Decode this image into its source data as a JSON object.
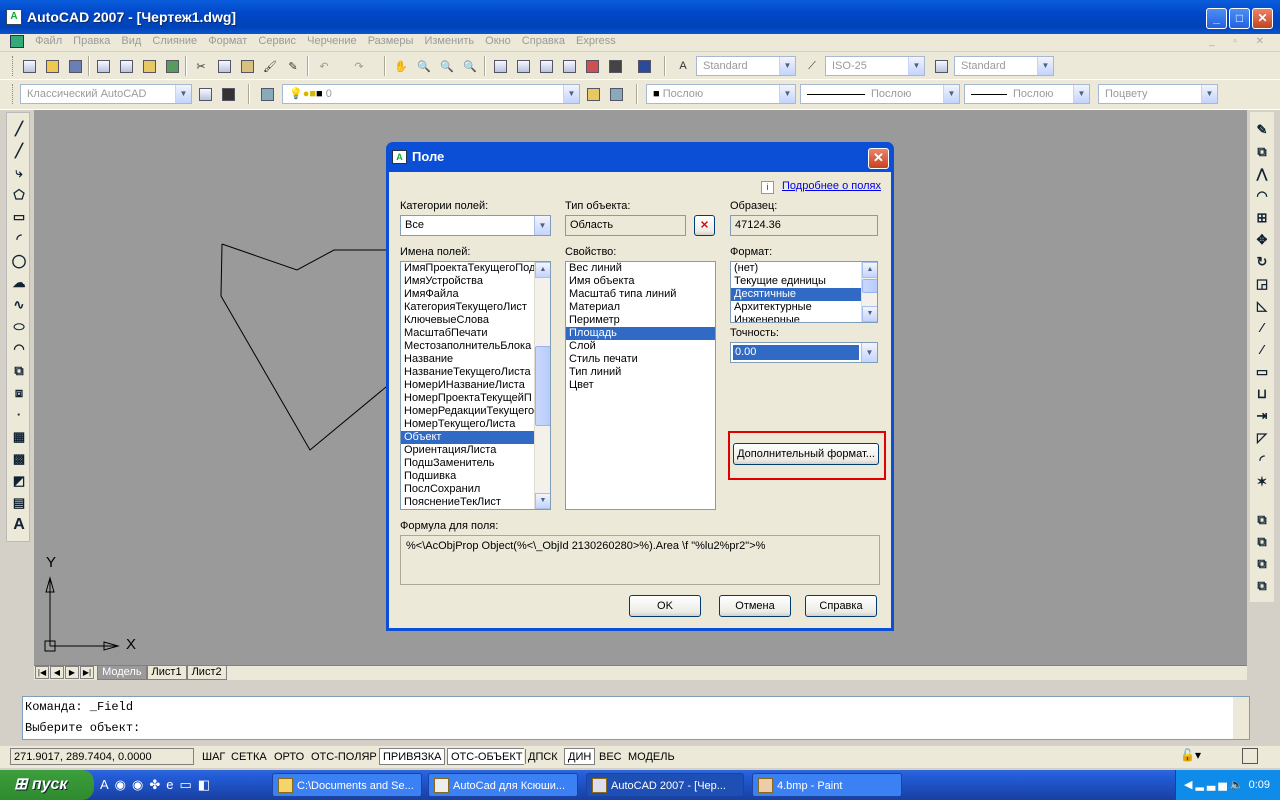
{
  "window": {
    "title": "AutoCAD 2007 - [Чертеж1.dwg]",
    "min": "_",
    "max": "□",
    "close": "✕"
  },
  "menu": [
    "Файл",
    "Правка",
    "Вид",
    "Слияние",
    "Формат",
    "Сервис",
    "Черчение",
    "Размеры",
    "Изменить",
    "Окно",
    "Справка",
    "Express"
  ],
  "toolbar": {
    "textstyle": "Standard",
    "dimstyle": "ISO-25",
    "tablestyle": "Standard",
    "workspace": "Классический AutoCAD",
    "layer": "0",
    "color": "Послою",
    "linetype": "Послою",
    "lineweight": "Послою",
    "plotstyle": "Поцвету"
  },
  "drawing": {
    "ucs_y": "Y",
    "ucs_x": "X"
  },
  "tabs": {
    "model": "Модель",
    "sheet1": "Лист1",
    "sheet2": "Лист2"
  },
  "command": {
    "line1": "Команда: _Field",
    "line2": "Выберите объект:"
  },
  "status": {
    "coords": "271.9017, 289.7404, 0.0000",
    "buttons": [
      "ШАГ",
      "СЕТКА",
      "ОРТО",
      "ОТС-ПОЛЯР",
      "ПРИВЯЗКА",
      "ОТС-ОБЪЕКТ",
      "ДПСК",
      "ДИН",
      "ВЕС",
      "МОДЕЛЬ"
    ]
  },
  "taskbar": {
    "start": "пуск",
    "items": [
      "C:\\Documents and Se...",
      "AutoCad для Ксюши...",
      "AutoCAD 2007 - [Чер...",
      "4.bmp - Paint"
    ],
    "clock": "0:09"
  },
  "dialog": {
    "title": "Поле",
    "more_link": "Подробнее о полях",
    "field_categories_label": "Категории полей:",
    "field_categories_value": "Все",
    "object_type_label": "Тип объекта:",
    "object_type_value": "Область",
    "sample_label": "Образец:",
    "sample_value": "47124.36",
    "field_names_label": "Имена полей:",
    "field_names": [
      "ИмяПроектаТекущегоПод",
      "ИмяУстройства",
      "ИмяФайла",
      "КатегорияТекущегоЛист",
      "КлючевыеСлова",
      "МасштабПечати",
      "МестозаполнительБлока",
      "Название",
      "НазваниеТекущегоЛиста",
      "НомерИНазваниеЛиста",
      "НомерПроектаТекущейП",
      "НомерРедакцииТекущего",
      "НомерТекущегоЛиста",
      "Объект",
      "ОриентацияЛиста",
      "ПодшЗаменитель",
      "Подшивка",
      "ПослСохранил",
      "ПояснениеТекЛист"
    ],
    "property_label": "Свойство:",
    "properties": [
      "Вес линий",
      "Имя объекта",
      "Масштаб типа линий",
      "Материал",
      "Периметр",
      "Площадь",
      "Слой",
      "Стиль печати",
      "Тип линий",
      "Цвет"
    ],
    "format_label": "Формат:",
    "formats": [
      "(нет)",
      "Текущие единицы",
      "Десятичные",
      "Архитектурные",
      "Инженерные"
    ],
    "precision_label": "Точность:",
    "precision_value": "0.00",
    "additional_format_button": "Дополнительный формат...",
    "formula_label": "Формула для поля:",
    "formula_value": "%<\\AcObjProp Object(%<\\_ObjId 2130260280>%).Area \\f \"%lu2%pr2\">%",
    "ok_button": "OK",
    "cancel_button": "Отмена",
    "help_button": "Справка"
  }
}
